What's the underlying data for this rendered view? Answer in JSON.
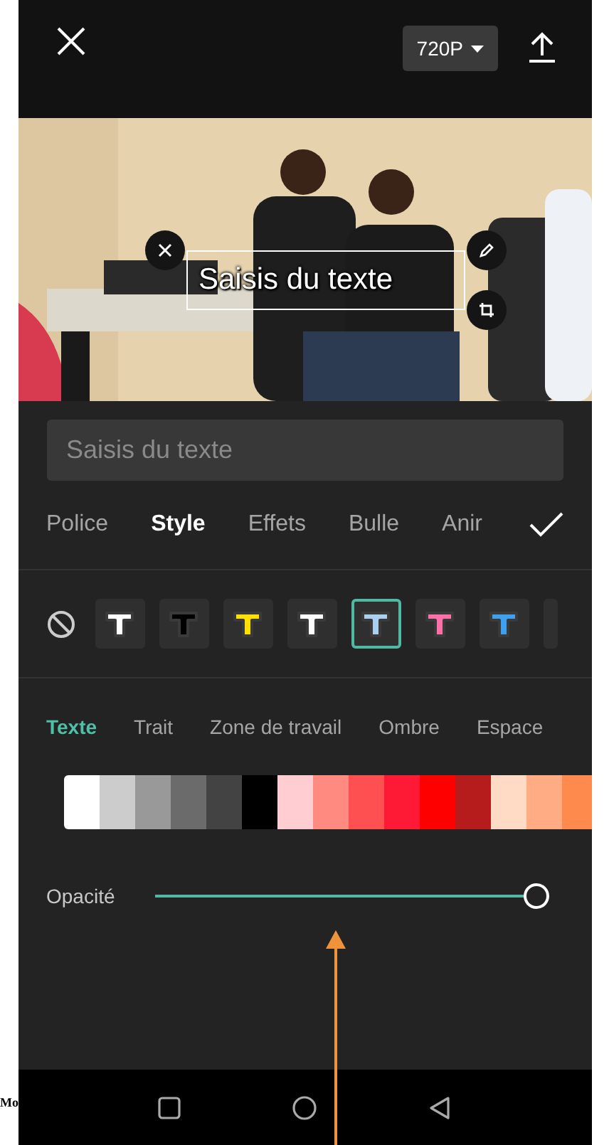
{
  "top_bar": {
    "resolution": "720P"
  },
  "preview": {
    "overlay_text": "Saisis du texte"
  },
  "text_field": {
    "placeholder": "Saisis du texte"
  },
  "tabs": [
    {
      "label": "Police",
      "selected": false
    },
    {
      "label": "Style",
      "selected": true
    },
    {
      "label": "Effets",
      "selected": false
    },
    {
      "label": "Bulle",
      "selected": false
    },
    {
      "label": "Anir",
      "selected": false
    }
  ],
  "presets": [
    {
      "color": "#ffffff",
      "selected": false
    },
    {
      "color": "#000000",
      "selected": false
    },
    {
      "color": "#ffe000",
      "selected": false
    },
    {
      "color": "#ffffff",
      "selected": false
    },
    {
      "color": "#a8d0f0",
      "selected": true
    },
    {
      "color": "#ff6fa8",
      "selected": false
    },
    {
      "color": "#3fa0f0",
      "selected": false
    }
  ],
  "sub_tabs": [
    {
      "label": "Texte",
      "selected": true
    },
    {
      "label": "Trait",
      "selected": false
    },
    {
      "label": "Zone de travail",
      "selected": false
    },
    {
      "label": "Ombre",
      "selected": false
    },
    {
      "label": "Espace",
      "selected": false
    }
  ],
  "swatches": [
    {
      "color": "#ffffff"
    },
    {
      "color": "#cccccc"
    },
    {
      "color": "#999999"
    },
    {
      "color": "#6b6b6b"
    },
    {
      "color": "#434343"
    },
    {
      "color": "#000000"
    },
    {
      "color": "#ffcdd2"
    },
    {
      "color": "#fe8a80"
    },
    {
      "color": "#fe5050"
    },
    {
      "color": "#fe1a35"
    },
    {
      "color": "#fe0000"
    },
    {
      "color": "#b71c1c"
    },
    {
      "color": "#ffdac4"
    },
    {
      "color": "#ffab84"
    },
    {
      "color": "#fe8a4e"
    }
  ],
  "opacity": {
    "label": "Opacité",
    "level": 1
  },
  "caption_fragment": "Mo"
}
